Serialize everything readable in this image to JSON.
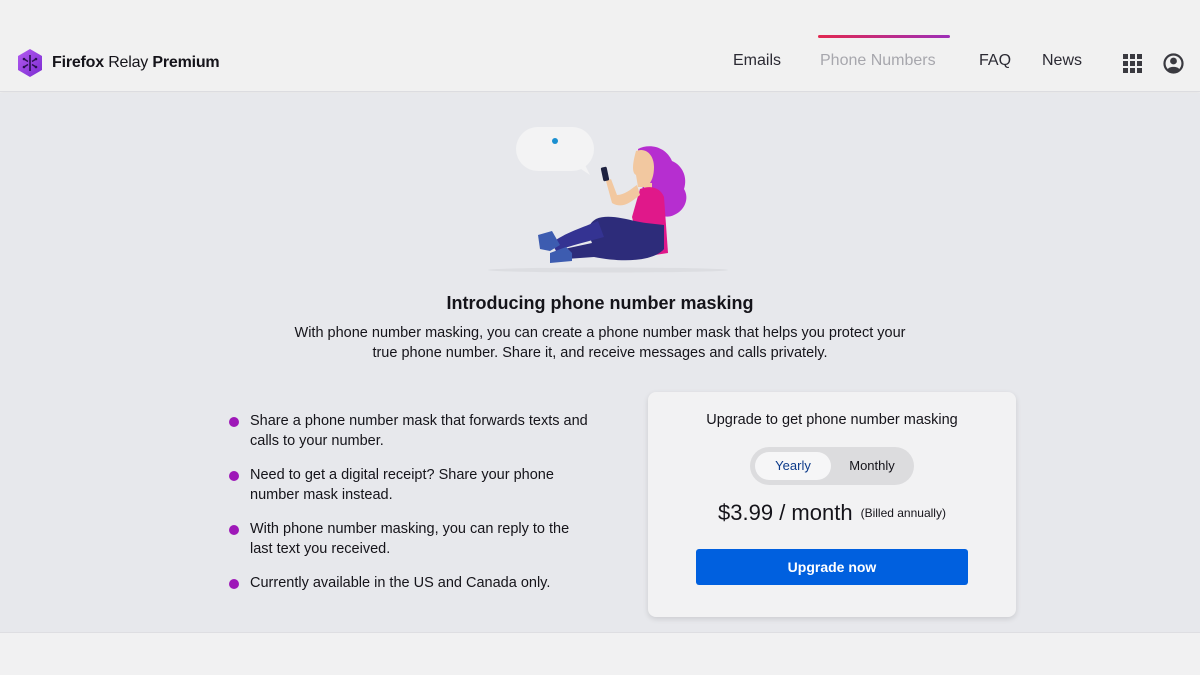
{
  "header": {
    "logo": {
      "icon": "firefox-relay-hexagon-icon",
      "brand_regular_1": "Firefox",
      "brand_regular_2": "Relay",
      "brand_bold": "Premium"
    },
    "nav": [
      {
        "label": "Emails",
        "active": false
      },
      {
        "label": "Phone Numbers",
        "active": true
      },
      {
        "label": "FAQ",
        "active": false
      },
      {
        "label": "News",
        "active": false
      }
    ],
    "icons": [
      "apps-grid-icon",
      "account-icon"
    ],
    "active_underline_colors": [
      "#e22850",
      "#9d2fb8"
    ]
  },
  "hero": {
    "illustration": "woman-sitting-with-phone-illustration",
    "title": "Introducing phone number masking",
    "description": "With phone number masking, you can create a phone number mask that helps you protect your true phone number. Share it, and receive messages and calls privately."
  },
  "features": [
    "Share a phone number mask that forwards texts and calls to your number.",
    "Need to get a digital receipt? Share your phone number mask instead.",
    "With phone number masking, you can reply to the last text you received.",
    "Currently available in the US and Canada only."
  ],
  "upgrade_card": {
    "title": "Upgrade to get phone number masking",
    "toggle": {
      "options": [
        "Yearly",
        "Monthly"
      ],
      "selected": "Yearly"
    },
    "price": "$3.99 / month",
    "billing_note": "(Billed annually)",
    "button_label": "Upgrade now"
  },
  "colors": {
    "accent_blue": "#0060df",
    "bullet_purple": "#9e18b8",
    "selected_toggle_text": "#0c3a8a"
  }
}
